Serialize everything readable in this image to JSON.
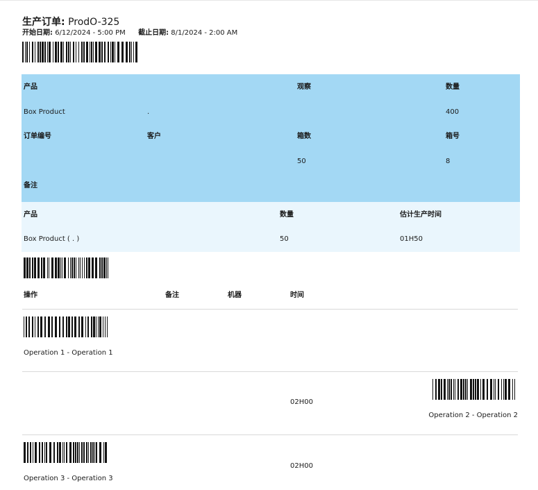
{
  "order": {
    "title_label": "生产订单:",
    "title_value": "ProdO-325",
    "start_label": "开始日期:",
    "start_value": "6/12/2024 - 5:00 PM",
    "deadline_label": "截止日期:",
    "deadline_value": "8/1/2024 - 2:00 AM"
  },
  "summary": {
    "labels": {
      "product": "产品",
      "observation": "观察",
      "quantity": "数量",
      "order_no": "订单编号",
      "customer": "客户",
      "box_count": "箱数",
      "box_no": "箱号",
      "notes": "备注"
    },
    "values": {
      "product": "Box Product",
      "product_dot": ".",
      "quantity": "400",
      "box_count": "50",
      "box_no": "8"
    }
  },
  "items": {
    "headers": [
      "产品",
      "数量",
      "估计生产时间"
    ],
    "rows": [
      [
        "Box Product ( . )",
        "50",
        "01H50"
      ]
    ]
  },
  "operations": {
    "headers": [
      "操作",
      "备注",
      "机器",
      "时间"
    ],
    "rows": [
      {
        "name": "Operation 1 - Operation 1",
        "time": ""
      },
      {
        "name": "Operation 2 - Operation 2",
        "time": "02H00"
      },
      {
        "name": "Operation 3 - Operation 3",
        "time": "02H00"
      }
    ]
  }
}
